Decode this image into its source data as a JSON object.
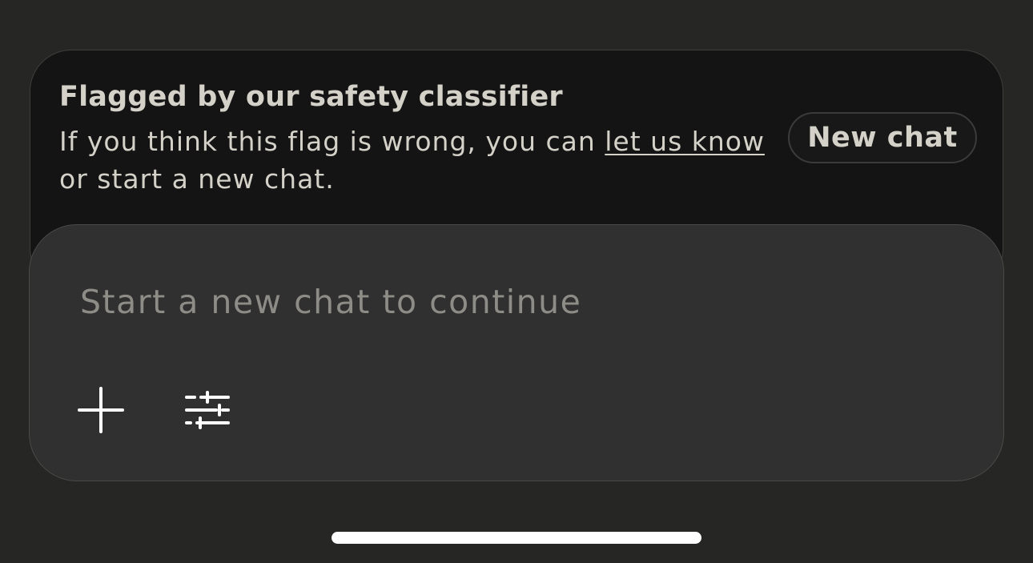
{
  "banner": {
    "title": "Flagged by our safety classifier",
    "body_prefix": "If you think this flag is wrong, you can ",
    "link_label": "let us know",
    "body_suffix": " or start a new chat.",
    "new_chat_label": "New chat"
  },
  "composer": {
    "placeholder": "Start a new chat to continue",
    "add_icon": "plus-icon",
    "tools_icon": "sliders-icon"
  },
  "colors": {
    "background": "#262625",
    "banner_bg": "#141414",
    "composer_bg": "#303030",
    "text": "#d4d1c8",
    "placeholder": "#8e8c86"
  }
}
